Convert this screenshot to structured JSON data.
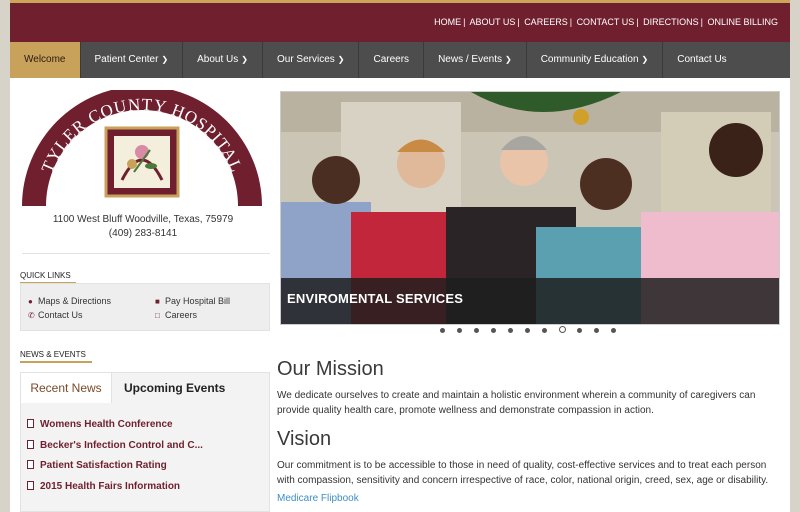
{
  "top_links": [
    "HOME",
    "ABOUT US",
    "CAREERS",
    "CONTACT US",
    "DIRECTIONS",
    "ONLINE BILLING"
  ],
  "nav": [
    {
      "label": "Welcome",
      "active": true,
      "dropdown": false
    },
    {
      "label": "Patient Center",
      "active": false,
      "dropdown": true
    },
    {
      "label": "About Us",
      "active": false,
      "dropdown": true
    },
    {
      "label": "Our Services",
      "active": false,
      "dropdown": true
    },
    {
      "label": "Careers",
      "active": false,
      "dropdown": false
    },
    {
      "label": "News / Events",
      "active": false,
      "dropdown": true
    },
    {
      "label": "Community Education",
      "active": false,
      "dropdown": true
    },
    {
      "label": "Contact Us",
      "active": false,
      "dropdown": false
    }
  ],
  "logo": {
    "text": "TYLER COUNTY HOSPITAL"
  },
  "address": {
    "line1": "1100 West Bluff Woodville, Texas, 75979",
    "phone": "(409) 283-8141"
  },
  "quick_links": {
    "title": "QUICK LINKS",
    "items": [
      {
        "label": "Maps & Directions",
        "icon": "map-pin-icon"
      },
      {
        "label": "Pay Hospital Bill",
        "icon": "credit-card-icon"
      },
      {
        "label": "Contact Us",
        "icon": "phone-icon"
      },
      {
        "label": "Careers",
        "icon": "document-icon"
      }
    ]
  },
  "news_events": {
    "title": "NEWS & EVENTS",
    "tabs": [
      "Recent News",
      "Upcoming Events"
    ],
    "items": [
      "Womens Health Conference",
      "Becker's Infection Control and C...",
      "Patient Satisfaction Rating",
      "2015 Health Fairs Information"
    ]
  },
  "slider": {
    "caption": "ENVIROMENTAL SERVICES",
    "slide_count": 11,
    "active_index": 7
  },
  "mission": {
    "title": "Our Mission",
    "text": "We dedicate ourselves to create and maintain a holistic environment wherein a community of caregivers can provide quality health care, promote wellness and demonstrate compassion in action."
  },
  "vision": {
    "title": "Vision",
    "text": "Our commitment is to be accessible to those in need of quality, cost-effective services and to treat each person with compassion, sensitivity and concern irrespective of race, color, national origin, creed, sex, age or disability.",
    "link": "Medicare Flipbook"
  },
  "colors": {
    "brand": "#6f1f2e",
    "accent": "#c8a25b",
    "nav": "#4d4d4d",
    "link": "#3d8ec6"
  }
}
